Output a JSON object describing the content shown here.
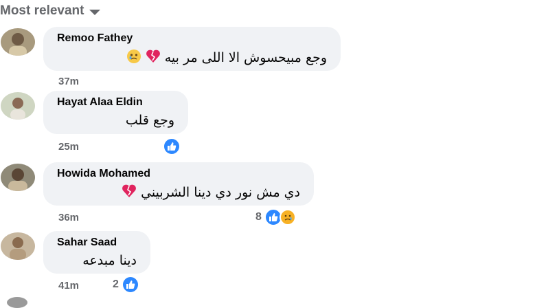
{
  "filter": {
    "label": "Most relevant"
  },
  "comments": [
    {
      "author": "Remoo Fathey",
      "text": "وجع مبيحسوش الا اللى مر بيه",
      "time": "37m",
      "reaction_count": ""
    },
    {
      "author": "Hayat Alaa Eldin",
      "text": "وجع قلب",
      "time": "25m",
      "reaction_count": ""
    },
    {
      "author": "Howida Mohamed",
      "text": "دي مش نور دي دينا الشربيني",
      "time": "36m",
      "reaction_count": "8"
    },
    {
      "author": "Sahar Saad",
      "text": "دينا مبدعه",
      "time": "41m",
      "reaction_count": "2"
    }
  ],
  "icons": {
    "filter_caret": "chevron-down-icon",
    "like": "like-icon",
    "sad": "sad-icon",
    "broken_heart": "broken-heart-emoji",
    "crying_face": "crying-face-emoji"
  },
  "colors": {
    "bubble": "#f0f2f5",
    "like": "#2d88ff",
    "meta": "#65676b",
    "heart": "#e0245e"
  }
}
